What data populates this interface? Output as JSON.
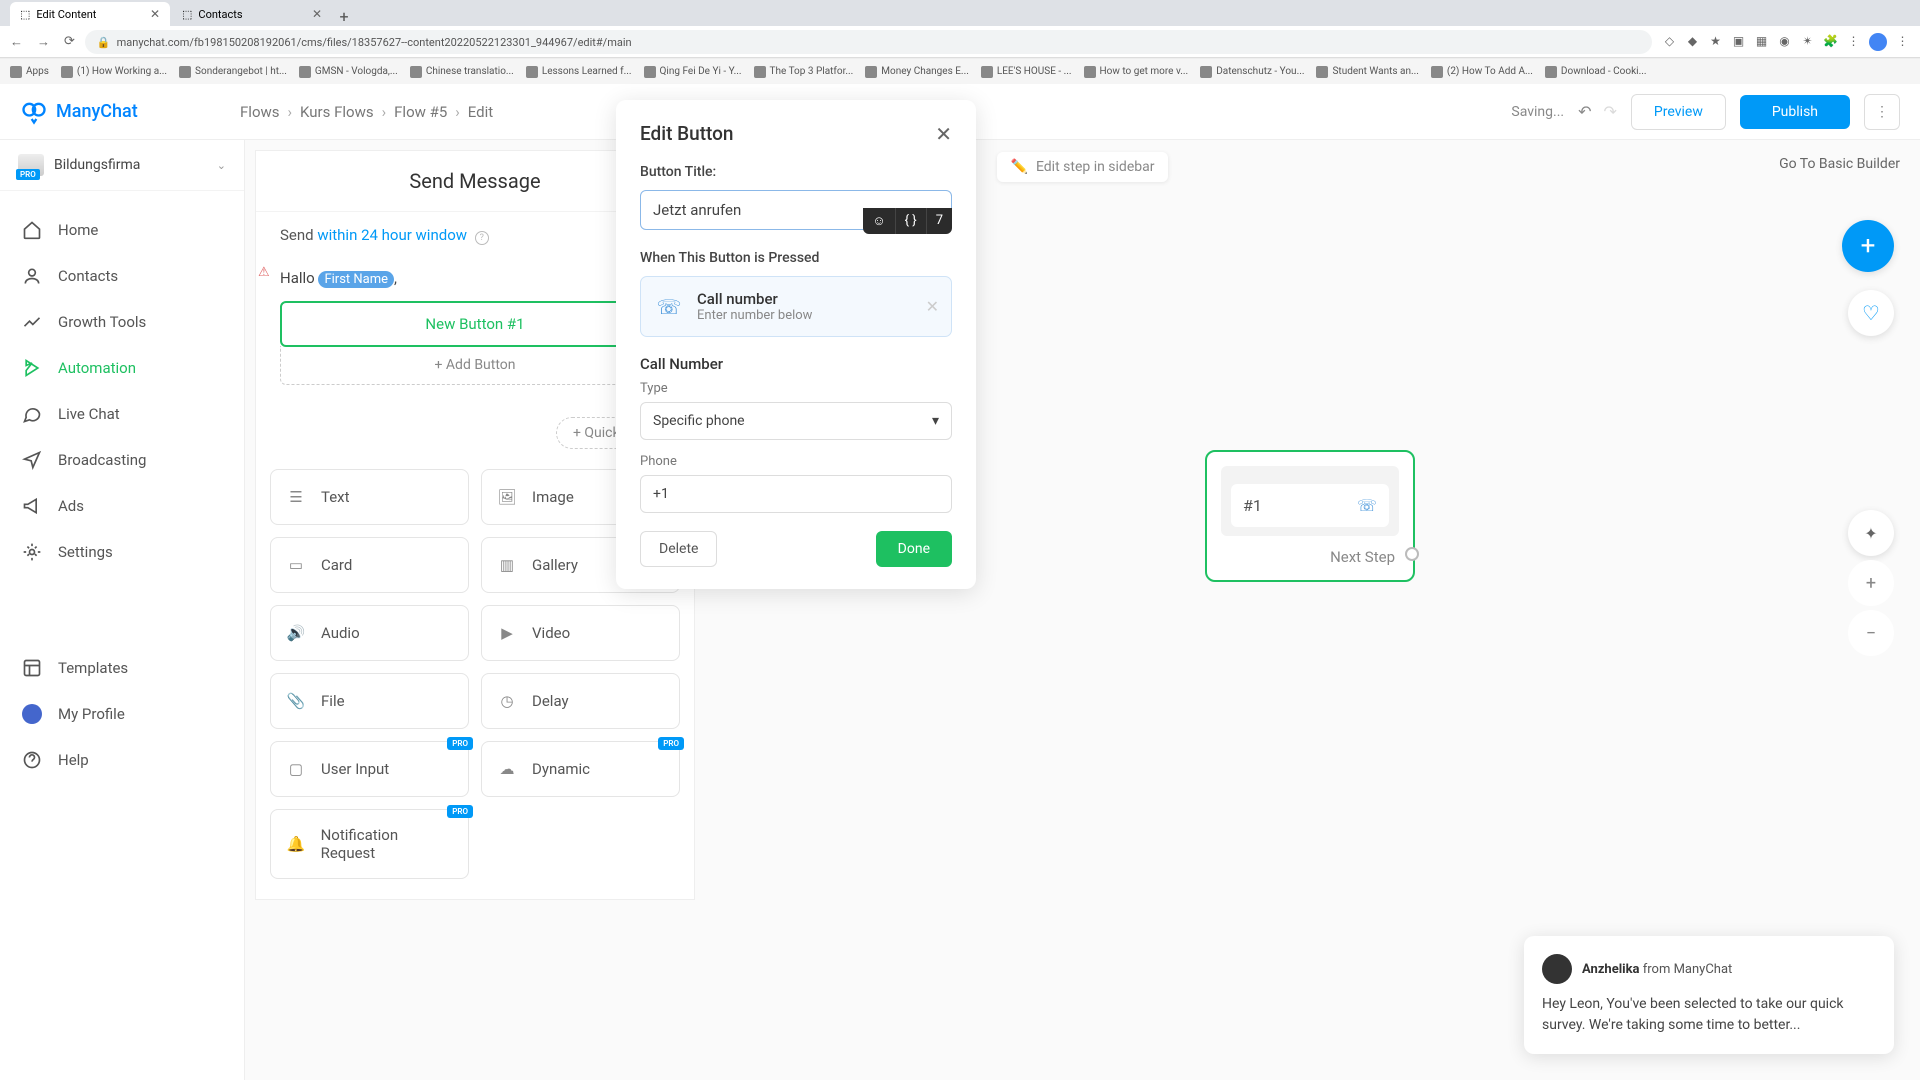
{
  "browser": {
    "tabs": [
      {
        "title": "Edit Content",
        "active": true
      },
      {
        "title": "Contacts",
        "active": false
      }
    ],
    "url": "manychat.com/fb198150208192061/cms/files/18357627--content20220522123301_944967/edit#/main",
    "bookmarks": [
      "Apps",
      "(1) How Working a...",
      "Sonderangebot | ht...",
      "GMSN - Vologda,...",
      "Chinese translatio...",
      "Lessons Learned f...",
      "Qing Fei De Yi - Y...",
      "The Top 3 Platfor...",
      "Money Changes E...",
      "LEE'S HOUSE - ...",
      "How to get more v...",
      "Datenschutz - You...",
      "Student Wants an...",
      "(2) How To Add A...",
      "Download - Cooki..."
    ]
  },
  "app": {
    "brand": "ManyChat",
    "breadcrumb": [
      "Flows",
      "Kurs Flows",
      "Flow #5",
      "Edit"
    ],
    "saving": "Saving...",
    "preview": "Preview",
    "publish": "Publish",
    "account": {
      "name": "Bildungsfirma",
      "badge": "PRO"
    },
    "nav": [
      {
        "label": "Home"
      },
      {
        "label": "Contacts"
      },
      {
        "label": "Growth Tools"
      },
      {
        "label": "Automation",
        "active": true
      },
      {
        "label": "Live Chat"
      },
      {
        "label": "Broadcasting"
      },
      {
        "label": "Ads"
      },
      {
        "label": "Settings"
      }
    ],
    "nav_bottom": [
      {
        "label": "Templates"
      },
      {
        "label": "My Profile"
      },
      {
        "label": "Help"
      }
    ]
  },
  "canvas": {
    "edit_sidebar": "Edit step in sidebar",
    "basic": "Go To Basic Builder",
    "editor": {
      "title": "Send Message",
      "send_prefix": "Send ",
      "send_link": "within 24 hour window",
      "greeting_prefix": "Hallo ",
      "greeting_token": "First Name",
      "button_label": "New Button #1",
      "add_button": "+ Add Button",
      "quick_reply": "+ Quick reply"
    },
    "blocks": [
      "Text",
      "Image",
      "Card",
      "Gallery",
      "Audio",
      "Video",
      "File",
      "Delay",
      "User Input",
      "Dynamic",
      "Notification Request"
    ],
    "node": {
      "button": "#1",
      "next": "Next Step"
    }
  },
  "modal": {
    "title": "Edit Button",
    "label_title": "Button Title:",
    "title_value": "Jetzt anrufen",
    "char_count": "7",
    "label_pressed": "When This Button is Pressed",
    "action_title": "Call number",
    "action_sub": "Enter number below",
    "label_callnum": "Call Number",
    "label_type": "Type",
    "type_value": "Specific phone",
    "label_phone": "Phone",
    "phone_value": "+1",
    "delete": "Delete",
    "done": "Done"
  },
  "chat": {
    "name": "Anzhelika",
    "from": " from ManyChat",
    "body": "Hey Leon,  You've been selected to take our quick survey. We're taking some time to better..."
  }
}
